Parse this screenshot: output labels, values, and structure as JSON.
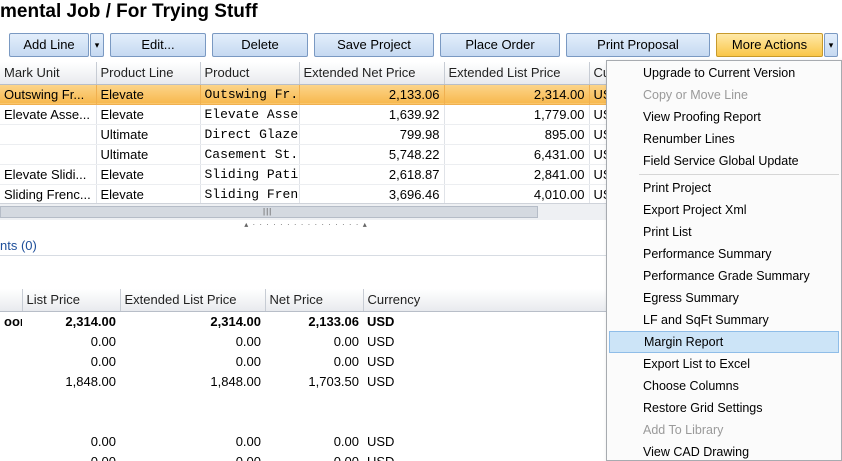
{
  "title": "mental Job / For Trying Stuff",
  "toolbar": {
    "add_line": "Add Line",
    "add_line_arrow": "▾",
    "edit": "Edit...",
    "delete": "Delete",
    "save_project": "Save Project",
    "place_order": "Place Order",
    "print_proposal": "Print Proposal",
    "more_actions": "More Actions",
    "more_actions_arrow": "▾"
  },
  "top_grid": {
    "headers": [
      "Mark Unit",
      "Product Line",
      "Product",
      "Extended Net Price",
      "Extended List Price",
      "Cu"
    ],
    "rows": [
      [
        "Outswing Fr...",
        "Elevate",
        "Outswing  Fr...",
        "2,133.06",
        "2,314.00",
        "US"
      ],
      [
        "Elevate Asse...",
        "Elevate",
        "Elevate  Asse...",
        "1,639.92",
        "1,779.00",
        "US"
      ],
      [
        "",
        "Ultimate",
        "Direct  Glaze...",
        "799.98",
        "895.00",
        "US"
      ],
      [
        "",
        "Ultimate",
        "Casement  St...",
        "5,748.22",
        "6,431.00",
        "US"
      ],
      [
        "Elevate Slidi...",
        "Elevate",
        "Sliding  Patio...",
        "2,618.87",
        "2,841.00",
        "US"
      ],
      [
        "Sliding Frenc...",
        "Elevate",
        "Sliding  Frenc...",
        "3,696.46",
        "4,010.00",
        "US"
      ]
    ]
  },
  "scroll_grip": "|||",
  "splitter_grip": "▴ · · · · · · · · · · · · · · · · ▴",
  "section": {
    "label": "nts (0)"
  },
  "bottom_grid": {
    "headers": [
      "",
      "List Price",
      "Extended List Price",
      "Net Price",
      "Currency"
    ],
    "rows": [
      [
        "oor",
        "2,314.00",
        "2,314.00",
        "2,133.06",
        "USD"
      ],
      [
        "",
        "0.00",
        "0.00",
        "0.00",
        "USD"
      ],
      [
        "",
        "0.00",
        "0.00",
        "0.00",
        "USD"
      ],
      [
        "",
        "1,848.00",
        "1,848.00",
        "1,703.50",
        "USD"
      ],
      [
        "",
        "",
        "",
        "",
        ""
      ],
      [
        "",
        "",
        "",
        "",
        ""
      ],
      [
        "",
        "0.00",
        "0.00",
        "0.00",
        "USD"
      ],
      [
        "",
        "0.00",
        "0.00",
        "0.00",
        "USD"
      ]
    ]
  },
  "menu": {
    "group1": [
      {
        "label": "Upgrade to Current Version",
        "enabled": true
      },
      {
        "label": "Copy or Move Line",
        "enabled": false
      },
      {
        "label": "View Proofing Report",
        "enabled": true
      },
      {
        "label": "Renumber Lines",
        "enabled": true
      },
      {
        "label": "Field Service Global Update",
        "enabled": true
      }
    ],
    "group2": [
      {
        "label": "Print Project",
        "enabled": true
      },
      {
        "label": "Export Project Xml",
        "enabled": true
      },
      {
        "label": "Print List",
        "enabled": true
      },
      {
        "label": "Performance Summary",
        "enabled": true
      },
      {
        "label": "Performance Grade Summary",
        "enabled": true
      },
      {
        "label": "Egress Summary",
        "enabled": true
      },
      {
        "label": "LF and SqFt Summary",
        "enabled": true
      },
      {
        "label": "Margin Report",
        "enabled": true,
        "highlighted": true
      },
      {
        "label": "Export List to Excel",
        "enabled": true
      },
      {
        "label": "Choose Columns",
        "enabled": true
      },
      {
        "label": "Restore Grid Settings",
        "enabled": true
      },
      {
        "label": "Add To Library",
        "enabled": false
      },
      {
        "label": "View CAD Drawing",
        "enabled": true
      }
    ]
  },
  "colors": {
    "selected_row": "#f7b84e",
    "menu_highlight": "#cce4f7",
    "active_button": "#f9c648",
    "link_text": "#1e4f9a"
  }
}
